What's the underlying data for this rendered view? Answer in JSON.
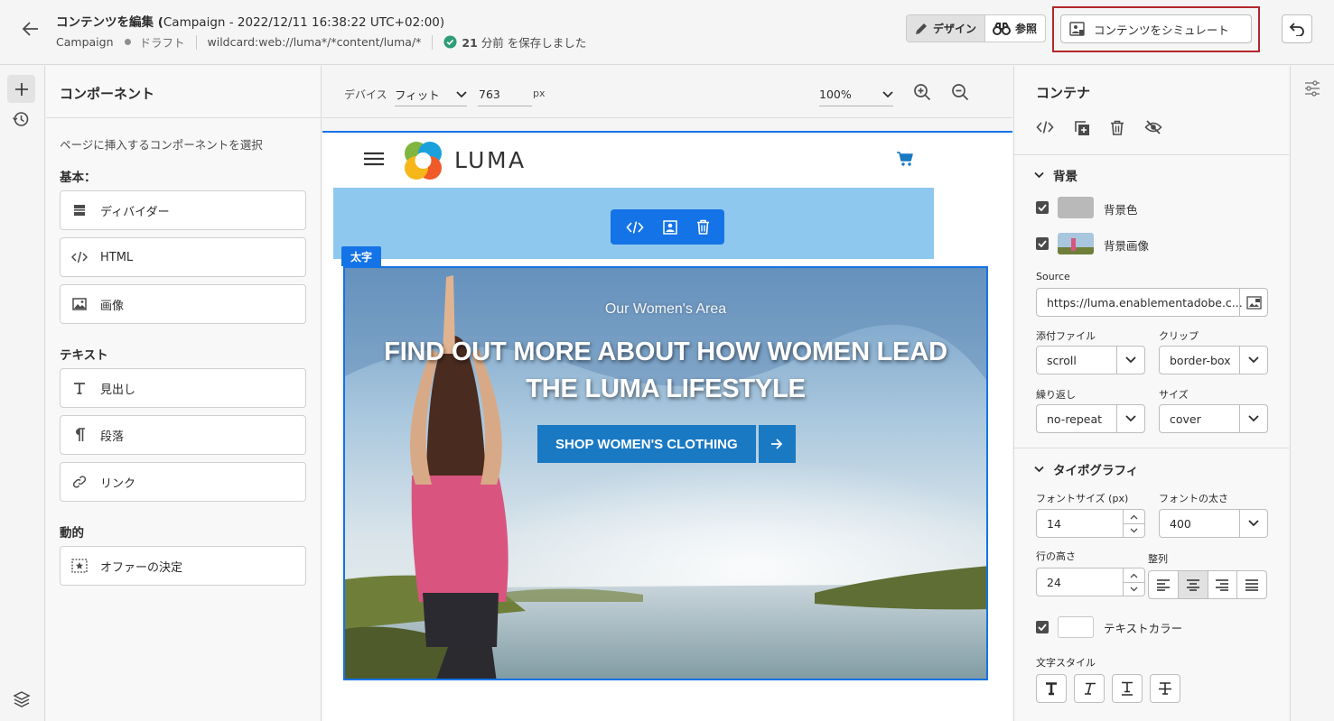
{
  "header": {
    "title_main": "コンテンツを編集 (",
    "title_campaign": "Campaign - 2022/12/11 16:38:22 UTC+02:00)",
    "type": "Campaign",
    "status": "ドラフト",
    "surface": "wildcard:web://luma*/*content/luma/*",
    "saved_num": "21",
    "saved_text": "分前 を保存しました",
    "design_label": "デザイン",
    "browse_label": "参照",
    "simulate_label": "コンテンツをシミュレート"
  },
  "components": {
    "title": "コンポーネント",
    "description": "ページに挿入するコンポーネントを選択",
    "basic": {
      "label": "基本：",
      "items": [
        {
          "label": "ディバイダー",
          "icon": "divider-icon"
        },
        {
          "label": "HTML",
          "icon": "code-icon"
        },
        {
          "label": "画像",
          "icon": "image-icon"
        }
      ]
    },
    "text": {
      "label": "テキスト",
      "items": [
        {
          "label": "見出し",
          "icon": "heading-icon"
        },
        {
          "label": "段落",
          "icon": "paragraph-icon"
        },
        {
          "label": "リンク",
          "icon": "link-icon"
        }
      ]
    },
    "dynamic": {
      "label": "動的",
      "items": [
        {
          "label": "オファーの決定",
          "icon": "offer-icon"
        }
      ]
    }
  },
  "canvas": {
    "device_label": "デバイス",
    "device_value": "フィット",
    "width_value": "763",
    "width_unit": "px",
    "zoom_value": "100%",
    "selected_tag": "太字",
    "brand": "LUMA",
    "hero_subtitle": "Our Women's Area",
    "hero_title_line1": "FIND OUT MORE ABOUT HOW WOMEN LEAD",
    "hero_title_line2": "THE LUMA LIFESTYLE",
    "cta_label": "SHOP WOMEN'S CLOTHING"
  },
  "properties": {
    "title": "コンテナ",
    "background": {
      "section_label": "背景",
      "color_label": "背景色",
      "color_value": "#b9b9b9",
      "image_label": "背景画像",
      "source_label": "Source",
      "source_value": "https://luma.enablementadobe.c...",
      "attachment_label": "添付ファイル",
      "attachment_value": "scroll",
      "clip_label": "クリップ",
      "clip_value": "border-box",
      "repeat_label": "繰り返し",
      "repeat_value": "no-repeat",
      "size_label": "サイズ",
      "size_value": "cover"
    },
    "typography": {
      "section_label": "タイポグラフィ",
      "font_size_label": "フォントサイズ (px)",
      "font_size_value": "14",
      "font_weight_label": "フォントの太さ",
      "font_weight_value": "400",
      "line_height_label": "行の高さ",
      "line_height_value": "24",
      "align_label": "整列",
      "text_color_label": "テキストカラー",
      "text_color_value": "#ffffff",
      "style_label": "文字スタイル"
    }
  },
  "colors": {
    "accent": "#1473e6",
    "highlight": "#b3262b",
    "luma_blue": "#1979c3",
    "sky_block": "#8fc8ee"
  }
}
